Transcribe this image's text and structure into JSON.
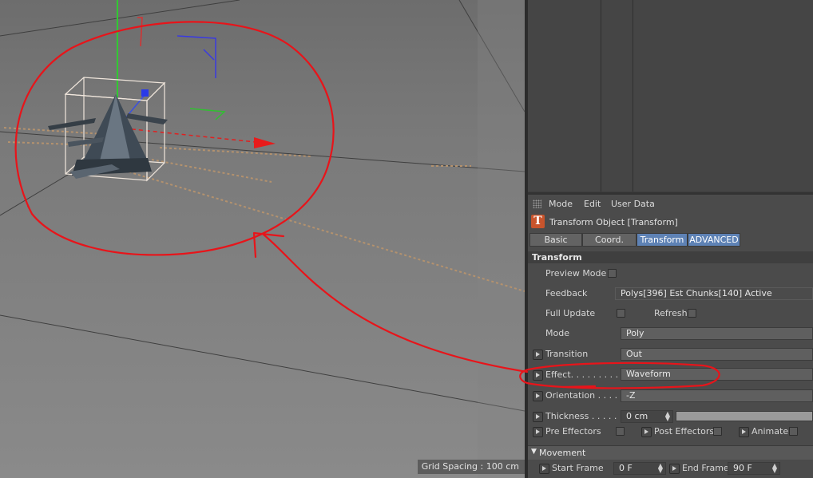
{
  "viewport": {
    "grid_spacing_label": "Grid Spacing : 100 cm"
  },
  "attributes": {
    "menu": {
      "mode": "Mode",
      "edit": "Edit",
      "user_data": "User Data"
    },
    "object_icon_letter": "T",
    "object_title": "Transform Object [Transform]",
    "tabs": {
      "basic": "Basic",
      "coord": "Coord.",
      "transform": "Transform",
      "advanced": "ADVANCED"
    },
    "section_title": "Transform",
    "preview_mode": "Preview Mode",
    "feedback_label": "Feedback",
    "feedback_value": "Polys[396]  Est Chunks[140]   Active",
    "full_update": "Full Update",
    "refresh": "Refresh",
    "mode_label": "Mode",
    "mode_value": "Poly",
    "transition_label": "Transition",
    "transition_value": "Out",
    "effect_label": "Effect. . . . . . . . . . .",
    "effect_value": "Waveform",
    "orientation_label": "Orientation . . . . .",
    "orientation_value": "-Z",
    "thickness_label": "Thickness . . . . . . .",
    "thickness_value": "0 cm",
    "pre_effectors": "Pre Effectors",
    "post_effectors": "Post Effectors",
    "animate": "Animate",
    "movement_section": "Movement",
    "start_frame_label": "Start Frame",
    "start_frame_value": "0 F",
    "end_frame_label": "End Frame",
    "end_frame_value": "90 F"
  },
  "colors": {
    "active_tab": "#5e82b5",
    "annotation": "#e8141a",
    "object_icon": "#c8542c"
  }
}
